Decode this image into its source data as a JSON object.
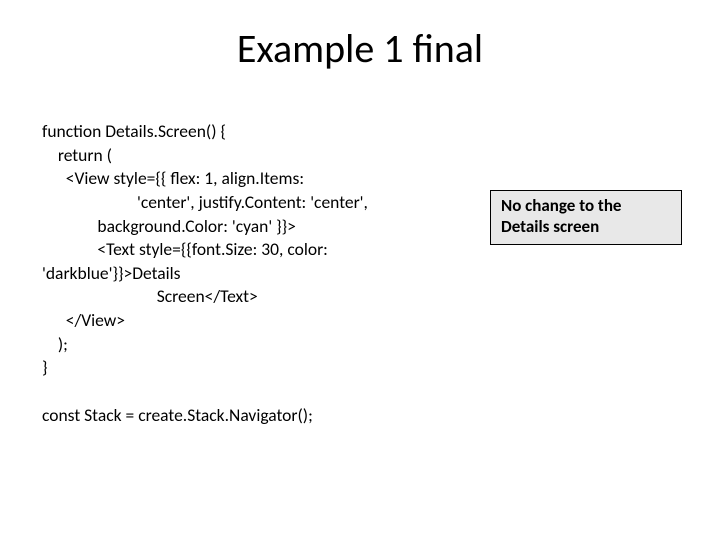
{
  "title": "Example 1 final",
  "code": "function Details.Screen() {\n    return (\n      <View style={{ flex: 1, align.Items:\n                        'center', justify.Content: 'center',\n              background.Color: 'cyan' }}>\n              <Text style={{font.Size: 30, color: 'darkblue'}}>Details\n                             Screen</Text>\n      </View>\n    );\n}\n\nconst Stack = create.Stack.Navigator();",
  "note": "No change to the Details screen"
}
